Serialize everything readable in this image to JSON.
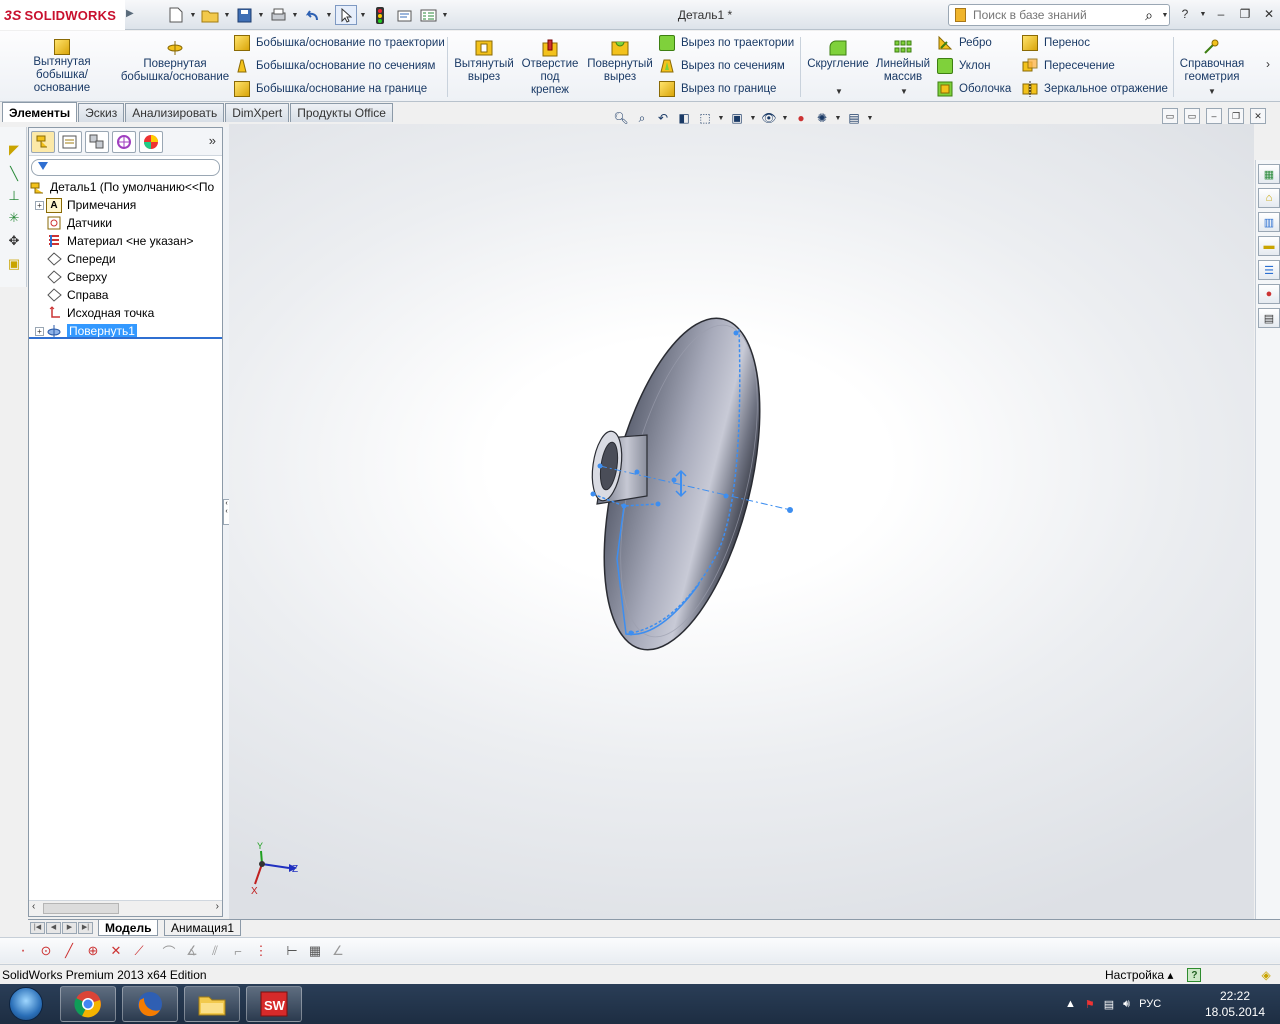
{
  "app": {
    "logo_text": "SOLIDWORKS",
    "doc_title": "Деталь1 *",
    "search_placeholder": "Поиск в базе знаний"
  },
  "command_manager": {
    "extruded_boss": "Вытянутая\nбобышка/основание",
    "revolved_boss": "Повернутая\nбобышка/основание",
    "swept_boss": "Бобышка/основание по траектории",
    "lofted_boss": "Бобышка/основание по сечениям",
    "boundary_boss": "Бобышка/основание на границе",
    "extruded_cut": "Вытянутый\nвырез",
    "hole_wizard": "Отверстие\nпод\nкрепеж",
    "revolved_cut": "Повернутый\nвырез",
    "swept_cut": "Вырез по траектории",
    "lofted_cut": "Вырез по сечениям",
    "boundary_cut": "Вырез по границе",
    "fillet": "Скругление",
    "linear_pattern": "Линейный\nмассив",
    "rib": "Ребро",
    "draft": "Уклон",
    "shell": "Оболочка",
    "wrap": "Перенос",
    "intersect": "Пересечение",
    "mirror": "Зеркальное отражение",
    "ref_geometry": "Справочная\nгеометрия"
  },
  "tabs": [
    "Элементы",
    "Эскиз",
    "Анализировать",
    "DimXpert",
    "Продукты Office"
  ],
  "feature_tree": {
    "root": "Деталь1  (По умолчанию<<По",
    "items": [
      {
        "label": "Примечания",
        "icon": "annotations-icon",
        "expandable": true
      },
      {
        "label": "Датчики",
        "icon": "sensors-icon",
        "expandable": false
      },
      {
        "label": "Материал <не указан>",
        "icon": "material-icon",
        "expandable": false
      },
      {
        "label": "Спереди",
        "icon": "plane-icon",
        "expandable": false
      },
      {
        "label": "Сверху",
        "icon": "plane-icon",
        "expandable": false
      },
      {
        "label": "Справа",
        "icon": "plane-icon",
        "expandable": false
      },
      {
        "label": "Исходная точка",
        "icon": "origin-icon",
        "expandable": false
      },
      {
        "label": "Повернуть1",
        "icon": "revolve-icon",
        "expandable": true,
        "selected": true
      }
    ]
  },
  "triad": {
    "y": "Y",
    "z": "Z",
    "x": "X"
  },
  "bottom_tabs": {
    "model": "Модель",
    "animation": "Анимация1"
  },
  "status": {
    "left": "SolidWorks Premium 2013 x64 Edition",
    "settings": "Настройка",
    "help": "?"
  },
  "taskbar": {
    "lang": "РУС",
    "time": "22:22",
    "date": "18.05.2014",
    "apps": [
      "chrome-icon",
      "firefox-icon",
      "explorer-icon",
      "solidworks-icon"
    ]
  },
  "colors": {
    "accent_blue": "#3399ff",
    "logo_red": "#c8102e",
    "sketch_blue": "#3d8ef0"
  }
}
